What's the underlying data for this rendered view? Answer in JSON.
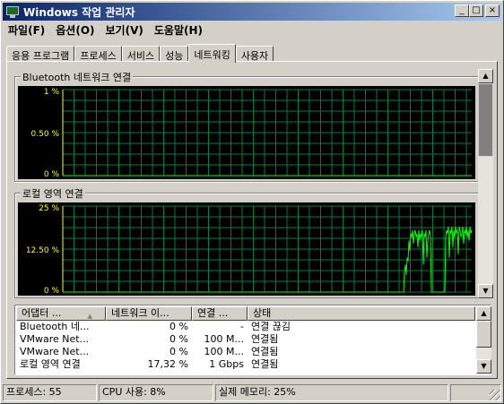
{
  "window": {
    "title": "Windows 작업 관리자",
    "controls": {
      "minimize": "_",
      "maximize": "□",
      "close": "×"
    }
  },
  "menu": [
    "파일(F)",
    "옵션(O)",
    "보기(V)",
    "도움말(H)"
  ],
  "tabs": [
    "응용 프로그램",
    "프로세스",
    "서비스",
    "성능",
    "네트워킹",
    "사용자"
  ],
  "active_tab": "네트워킹",
  "colors": {
    "graph_bg": "#000000",
    "grid": "#008040",
    "line": "#00ff00",
    "scale_text": "#ffff00",
    "title_start": "#0a246a",
    "title_end": "#a6caf0"
  },
  "graphs": {
    "bluetooth": {
      "title": "Bluetooth 네트워크 연결",
      "scale_labels": [
        "1 %",
        "0.50 %",
        "0 %"
      ]
    },
    "local": {
      "title": "로컬 영역 연결",
      "scale_labels": [
        "25 %",
        "12.50 %",
        "0 %"
      ]
    }
  },
  "chart_data": [
    {
      "type": "line",
      "title": "Bluetooth 네트워크 연결",
      "ylim": [
        0,
        1
      ],
      "y_ticks": [
        "1 %",
        "0.50 %",
        "0 %"
      ],
      "grid": true,
      "series": [
        {
          "values": [
            0,
            0,
            0,
            0,
            0,
            0,
            0,
            0,
            0,
            0,
            0,
            0,
            0,
            0,
            0,
            0,
            0,
            0,
            0,
            0,
            0,
            0,
            0,
            0,
            0,
            0,
            0,
            0,
            0,
            0,
            0,
            0,
            0,
            0,
            0,
            0,
            0,
            0,
            0,
            0,
            0,
            0,
            0,
            0,
            0,
            0,
            0,
            0,
            0,
            0,
            0,
            0,
            0,
            0,
            0,
            0,
            0,
            0,
            0,
            0
          ]
        }
      ]
    },
    {
      "type": "line",
      "title": "로컬 영역 연결",
      "ylim": [
        0,
        25
      ],
      "y_ticks": [
        "25 %",
        "12.50 %",
        "0 %"
      ],
      "grid": true,
      "series": [
        {
          "values": [
            0,
            0,
            0,
            0,
            0,
            0,
            0,
            0,
            0,
            0,
            0,
            0,
            0,
            0,
            0,
            0,
            0,
            0,
            0,
            0,
            0,
            0,
            0,
            0,
            0,
            0,
            0,
            0,
            0,
            0,
            0,
            0,
            0,
            0,
            0,
            0,
            0,
            0,
            0,
            0,
            0,
            0,
            0,
            0,
            0,
            0,
            0,
            0,
            0,
            0,
            0,
            0,
            0,
            0,
            0,
            0,
            0,
            0,
            0,
            0,
            0,
            0,
            0,
            0,
            0,
            0,
            0,
            0,
            0,
            0,
            0,
            0,
            0,
            0,
            0,
            0,
            0,
            0,
            0,
            0,
            0,
            0,
            0,
            0,
            0,
            0,
            0,
            0,
            0,
            0,
            0,
            0,
            0,
            0,
            0,
            0,
            0,
            0,
            0,
            0,
            0,
            0,
            0,
            0,
            0,
            0,
            0,
            0,
            0,
            0,
            0,
            0,
            0,
            0,
            0,
            0,
            0,
            0,
            0,
            0,
            0,
            0,
            0,
            0,
            0,
            0,
            0,
            0,
            0,
            0,
            0,
            0,
            0,
            0,
            0,
            0,
            0,
            0,
            0,
            0,
            0,
            0,
            0,
            0,
            0,
            0,
            0,
            0,
            0,
            0,
            0,
            0,
            0,
            0,
            0,
            0,
            0,
            0,
            0,
            0,
            0,
            0,
            0,
            0,
            0,
            0,
            0,
            0,
            0,
            0,
            0,
            0,
            0,
            0,
            0,
            0,
            0,
            0,
            0,
            0,
            0,
            0,
            0,
            0,
            0,
            0,
            0,
            0,
            0,
            0,
            0,
            0,
            0,
            0,
            0,
            0,
            0,
            0,
            0,
            0,
            0,
            0,
            0,
            0,
            0,
            0,
            0,
            0,
            0,
            0,
            0,
            0,
            0,
            0,
            0,
            0,
            0,
            0,
            0,
            0,
            0,
            0,
            0,
            0,
            0,
            0,
            0,
            0,
            0,
            0,
            0,
            0,
            0,
            0,
            0,
            0,
            0,
            0,
            0,
            0,
            0,
            0,
            0,
            0,
            0,
            0,
            0,
            0,
            0,
            0,
            0,
            0,
            0,
            0,
            0,
            0,
            0,
            0,
            0,
            0,
            0,
            0,
            0,
            0,
            0,
            0,
            0,
            0,
            0,
            0,
            0,
            0,
            0,
            0,
            0,
            0,
            0,
            0,
            0,
            0,
            0,
            0,
            0,
            0,
            0,
            0,
            0,
            0,
            0,
            0,
            0,
            0,
            0,
            0,
            0,
            0,
            0,
            0,
            0,
            0,
            0,
            0,
            0,
            0,
            0,
            0,
            0,
            0,
            0,
            0,
            0,
            0,
            0,
            0,
            0,
            0,
            0,
            0,
            0,
            0,
            0,
            0,
            0,
            0,
            0,
            0,
            0,
            0,
            0,
            0,
            0,
            0,
            0,
            0,
            0,
            0,
            0,
            0,
            0,
            0,
            0,
            6,
            8,
            5,
            10,
            9,
            15,
            12,
            17,
            16,
            18,
            14,
            17,
            18,
            16,
            17,
            13,
            18,
            15,
            17,
            16,
            18,
            8,
            17,
            16,
            18,
            10,
            15,
            17,
            18,
            16,
            0,
            0,
            0,
            0,
            0,
            0,
            0,
            0,
            0,
            0,
            0,
            0,
            0,
            0,
            0,
            0,
            16,
            18,
            17,
            19,
            10,
            18,
            17,
            19,
            13,
            18,
            16,
            19,
            17,
            18,
            11,
            19,
            18,
            16,
            17,
            19,
            14,
            18,
            17,
            19,
            16,
            18,
            15,
            19,
            17,
            18
          ]
        }
      ]
    }
  ],
  "adapter_list": {
    "columns": [
      "어댑터 ...",
      "네트워크 이...",
      "연결 ...",
      "상태"
    ],
    "rows": [
      [
        "Bluetooth 네...",
        "0 %",
        "-",
        "연결 끊김"
      ],
      [
        "VMware Net...",
        "0 %",
        "100 M...",
        "연결됨"
      ],
      [
        "VMware Net...",
        "0 %",
        "100 M...",
        "연결됨"
      ],
      [
        "로컬 영역 연결",
        "17,32 %",
        "1 Gbps",
        "연결됨"
      ]
    ]
  },
  "status": {
    "processes": "프로세스: 55",
    "cpu": "CPU 사용: 8%",
    "memory": "실제 메모리: 25%"
  }
}
